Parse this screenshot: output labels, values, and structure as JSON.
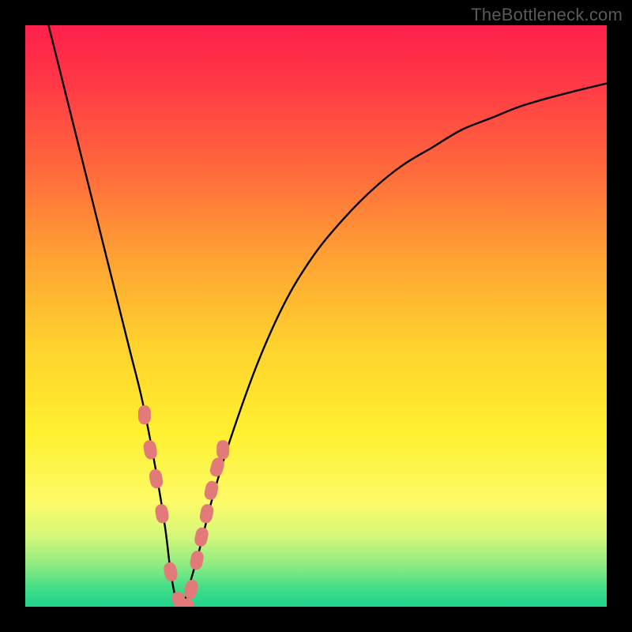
{
  "watermark": "TheBottleneck.com",
  "chart_data": {
    "type": "line",
    "title": "",
    "xlabel": "",
    "ylabel": "",
    "xlim": [
      0,
      100
    ],
    "ylim": [
      0,
      100
    ],
    "grid": false,
    "legend": false,
    "background_gradient": {
      "stops": [
        {
          "pos": 0.0,
          "color": "#ff1f4b"
        },
        {
          "pos": 0.1,
          "color": "#ff3946"
        },
        {
          "pos": 0.25,
          "color": "#ff6a3c"
        },
        {
          "pos": 0.4,
          "color": "#ffa233"
        },
        {
          "pos": 0.55,
          "color": "#ffd22e"
        },
        {
          "pos": 0.7,
          "color": "#fff02f"
        },
        {
          "pos": 0.82,
          "color": "#fdfb68"
        },
        {
          "pos": 0.88,
          "color": "#d3f77a"
        },
        {
          "pos": 0.93,
          "color": "#8beb81"
        },
        {
          "pos": 0.97,
          "color": "#3fdc87"
        },
        {
          "pos": 1.0,
          "color": "#1fd28b"
        }
      ]
    },
    "series": [
      {
        "name": "curve",
        "color": "#000000",
        "x": [
          4,
          6,
          8,
          10,
          12,
          14,
          16,
          18,
          20,
          22,
          24,
          25,
          26,
          27,
          28,
          30,
          32,
          35,
          40,
          45,
          50,
          55,
          60,
          65,
          70,
          75,
          80,
          85,
          90,
          95,
          100
        ],
        "y": [
          100,
          92,
          84,
          76,
          68,
          60,
          52,
          44,
          36,
          26,
          14,
          6,
          1,
          0,
          3,
          10,
          18,
          28,
          42,
          53,
          61,
          67,
          72,
          76,
          79,
          82,
          84,
          86,
          87.5,
          88.8,
          90
        ]
      },
      {
        "name": "markers",
        "color": "#e37a7a",
        "type": "scatter",
        "x": [
          20.5,
          21.5,
          22.5,
          23.5,
          25.0,
          26.5,
          27.5,
          28.5,
          29.5,
          30.3,
          31.2,
          32.0,
          33.0,
          34.0
        ],
        "y": [
          33,
          27,
          22,
          16,
          6,
          1,
          0,
          3,
          8,
          12,
          16,
          20,
          24,
          27
        ]
      }
    ]
  }
}
